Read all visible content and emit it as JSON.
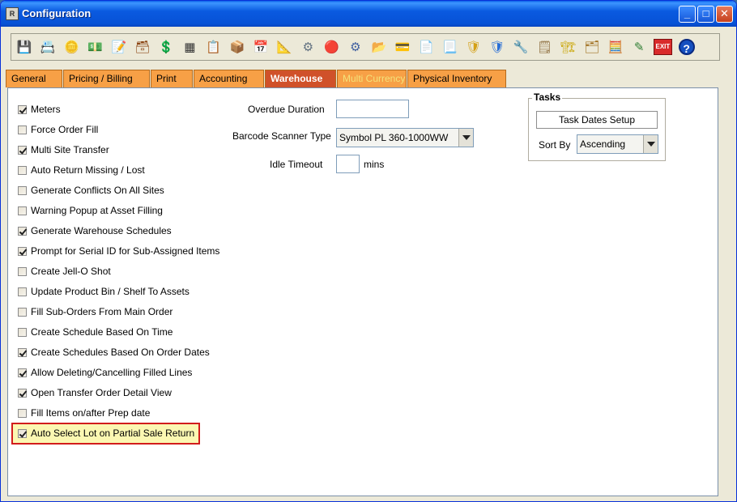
{
  "window": {
    "title": "Configuration",
    "icon": "app-icon"
  },
  "toolbar": {
    "buttons": [
      {
        "icon": "save-icon",
        "glyph": "💾",
        "color": "#2b5fb0"
      },
      {
        "icon": "customer-alert-icon",
        "glyph": "📇",
        "color": "#c0392b"
      },
      {
        "icon": "coins-alert-icon",
        "glyph": "🪙",
        "color": "#b8860b"
      },
      {
        "icon": "invoice-dollar-alert-icon",
        "glyph": "💵",
        "color": "#2e7d32"
      },
      {
        "icon": "edit-document-icon",
        "glyph": "📝",
        "color": "#555555"
      },
      {
        "icon": "register-alert-icon",
        "glyph": "🗃",
        "color": "#8b4513"
      },
      {
        "icon": "dollar-alert-icon",
        "glyph": "💲",
        "color": "#006400"
      },
      {
        "icon": "grid-alert-icon",
        "glyph": "▦",
        "color": "#333333"
      },
      {
        "icon": "list-alert-icon",
        "glyph": "📋",
        "color": "#556b2f"
      },
      {
        "icon": "transfer-icon",
        "glyph": "📦",
        "color": "#1e6fb5"
      },
      {
        "icon": "calendar-icon",
        "glyph": "📅",
        "color": "#2d2d2d"
      },
      {
        "icon": "ruler-icon",
        "glyph": "📐",
        "color": "#1560bd"
      },
      {
        "icon": "gears-icon",
        "glyph": "⚙",
        "color": "#607080"
      },
      {
        "icon": "color-balls-icon",
        "glyph": "🔴",
        "color": "#e03a3a"
      },
      {
        "icon": "settings-gear-icon",
        "glyph": "⚙",
        "color": "#4060a0"
      },
      {
        "icon": "folder-clock-icon",
        "glyph": "📂",
        "color": "#d4a017"
      },
      {
        "icon": "card-icon",
        "glyph": "💳",
        "color": "#2a6fd6"
      },
      {
        "icon": "document-add-icon",
        "glyph": "📄",
        "color": "#3a7d3a"
      },
      {
        "icon": "document-search-icon",
        "glyph": "📃",
        "color": "#3a5fa0"
      },
      {
        "icon": "shield-tools-icon",
        "glyph": "🛡",
        "color": "#d4a017"
      },
      {
        "icon": "shield-icon",
        "glyph": "🛡",
        "color": "#2a6fd6"
      },
      {
        "icon": "tools-icon",
        "glyph": "🔧",
        "color": "#777777"
      },
      {
        "icon": "notes-icon",
        "glyph": "🗒",
        "color": "#8b6a3a"
      },
      {
        "icon": "crane-icon",
        "glyph": "🏗",
        "color": "#c9a400"
      },
      {
        "icon": "folder-gear-icon",
        "glyph": "🗂",
        "color": "#a07020"
      },
      {
        "icon": "calculator-icon",
        "glyph": "🧮",
        "color": "#2e5e2e"
      },
      {
        "icon": "edit-arrows-icon",
        "glyph": "✎",
        "color": "#2e7d32"
      },
      {
        "icon": "exit-icon",
        "glyph": "EXIT",
        "color": "#d92b2b"
      },
      {
        "icon": "help-icon",
        "glyph": "?",
        "color": "#1550c0"
      }
    ]
  },
  "tabs": [
    {
      "label": "General",
      "state": "normal"
    },
    {
      "label": "Pricing / Billing",
      "state": "normal"
    },
    {
      "label": "Print",
      "state": "normal"
    },
    {
      "label": "Accounting",
      "state": "normal"
    },
    {
      "label": "Warehouse",
      "state": "active"
    },
    {
      "label": "Multi Currency",
      "state": "disabled"
    },
    {
      "label": "Physical Inventory",
      "state": "normal"
    }
  ],
  "options": [
    {
      "label": "Meters",
      "checked": true
    },
    {
      "label": "Force Order Fill",
      "checked": false
    },
    {
      "label": "Multi Site Transfer",
      "checked": true
    },
    {
      "label": "Auto Return Missing / Lost",
      "checked": false
    },
    {
      "label": "Generate Conflicts On All Sites",
      "checked": false
    },
    {
      "label": "Warning Popup at Asset Filling",
      "checked": false
    },
    {
      "label": "Generate Warehouse Schedules",
      "checked": true
    },
    {
      "label": "Prompt for Serial ID for Sub-Assigned Items",
      "checked": true
    },
    {
      "label": "Create Jell-O Shot",
      "checked": false
    },
    {
      "label": "Update Product Bin / Shelf To Assets",
      "checked": false
    },
    {
      "label": "Fill Sub-Orders From Main Order",
      "checked": false
    },
    {
      "label": "Create Schedule Based On Time",
      "checked": false
    },
    {
      "label": "Create Schedules Based On Order Dates",
      "checked": true
    },
    {
      "label": "Allow Deleting/Cancelling Filled Lines",
      "checked": true
    },
    {
      "label": "Open Transfer Order Detail View",
      "checked": true
    },
    {
      "label": "Fill Items on/after Prep date",
      "checked": false
    },
    {
      "label": "Auto Select Lot on Partial Sale Return",
      "checked": true,
      "highlighted": true
    }
  ],
  "fields": {
    "overdue_duration_label": "Overdue Duration",
    "overdue_duration_value": "",
    "barcode_label": "Barcode Scanner Type",
    "barcode_value": "Symbol PL 360-1000WW",
    "idle_timeout_label": "Idle Timeout",
    "idle_timeout_value": "",
    "idle_timeout_unit": "mins"
  },
  "tasks": {
    "title": "Tasks",
    "setup_button": "Task Dates Setup",
    "sort_by_label": "Sort By",
    "sort_by_value": "Ascending"
  },
  "colors": {
    "tab": "#f7a046",
    "tab_active": "#d0512a",
    "highlight_border": "#d21c1c",
    "highlight_fill": "#fbf7b2"
  }
}
